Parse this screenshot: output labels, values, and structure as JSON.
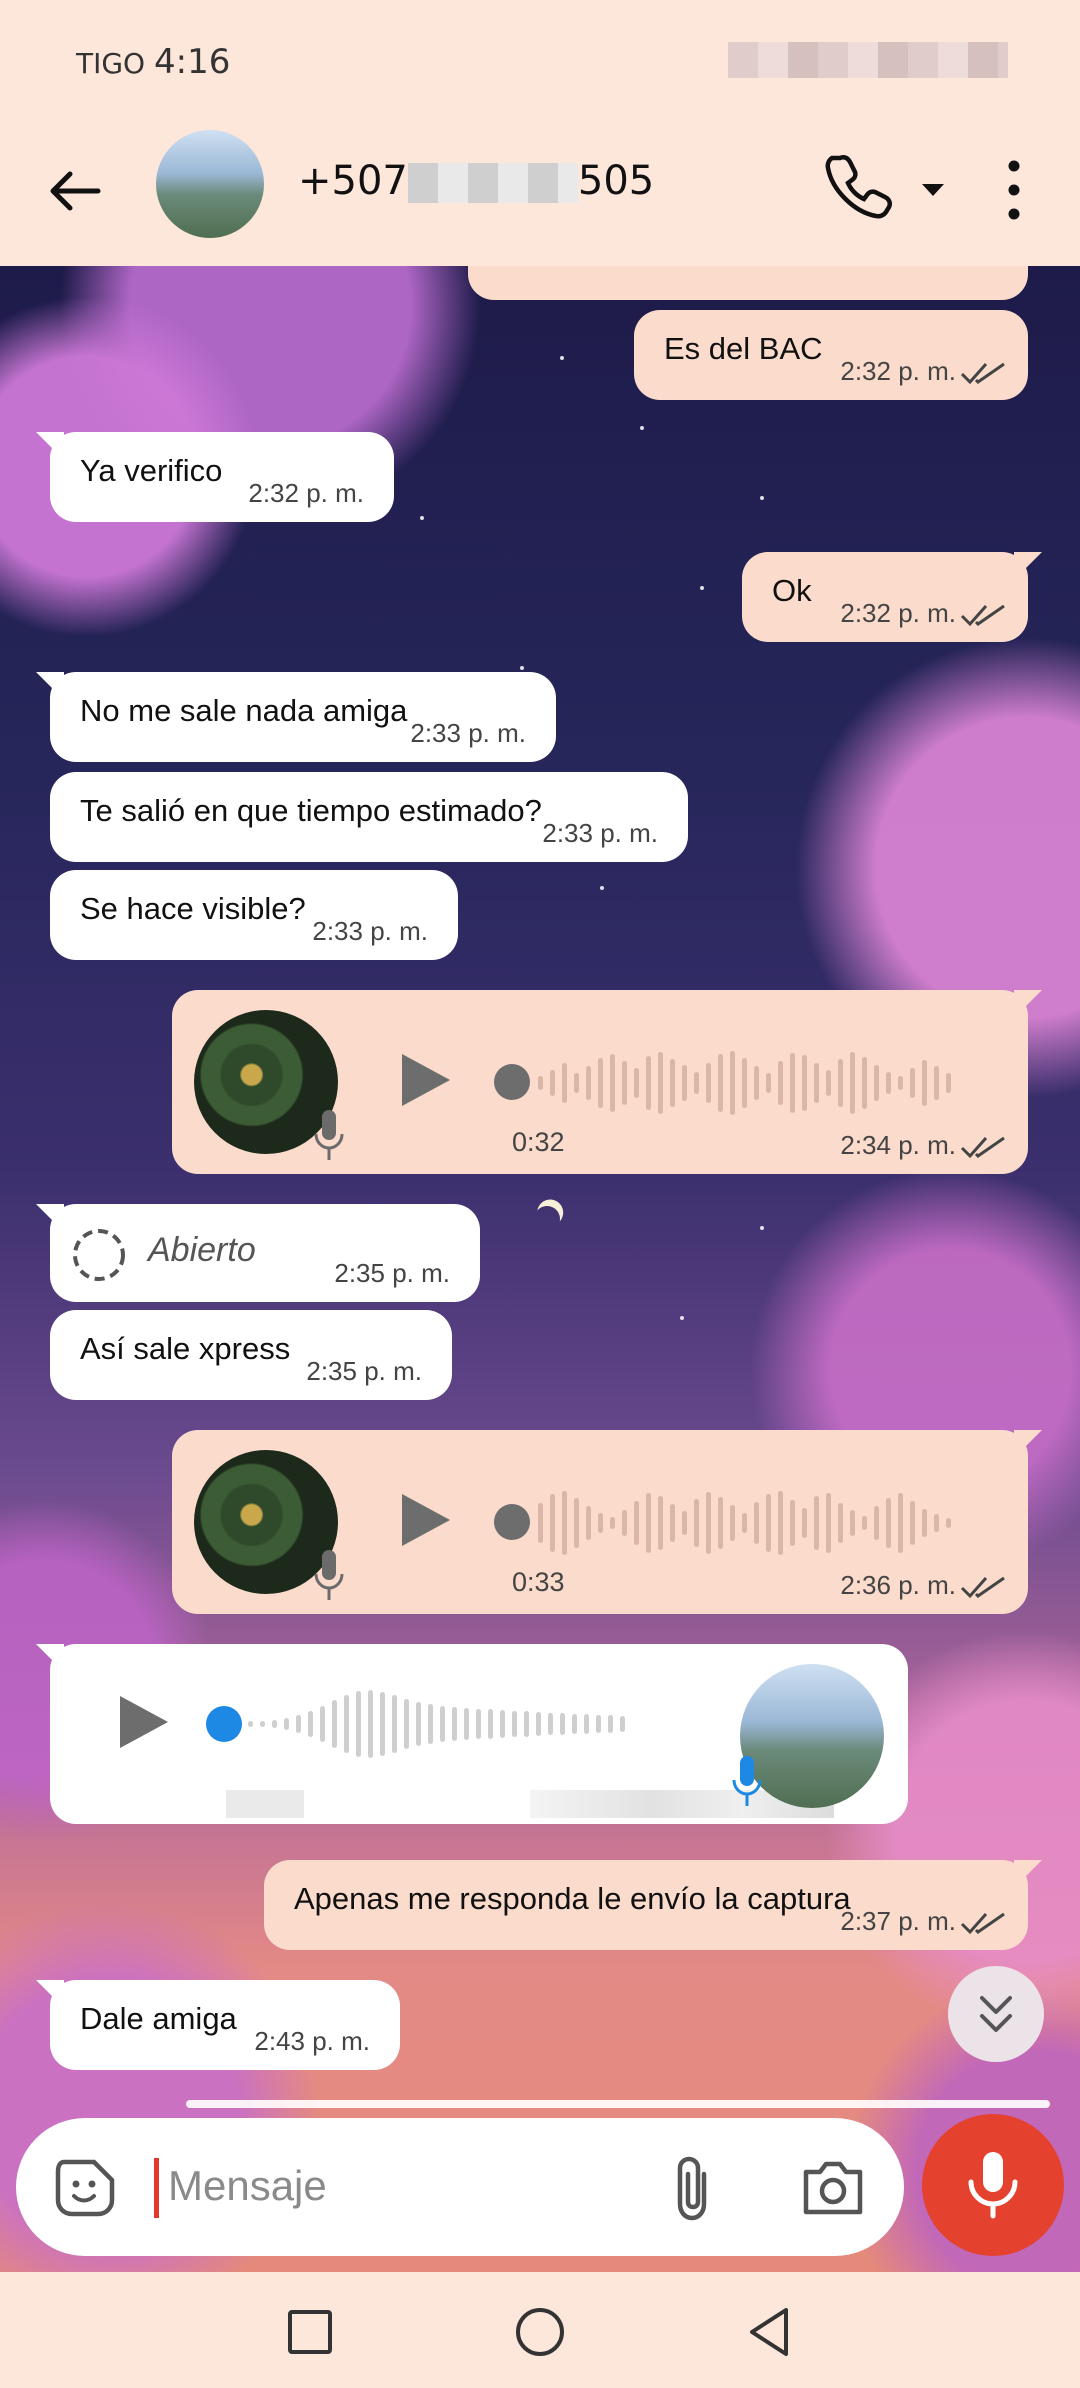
{
  "status_bar": {
    "carrier": "TIGO",
    "time": "4:16"
  },
  "header": {
    "contact_prefix": "+507",
    "contact_suffix": "505"
  },
  "messages": [
    {
      "dir": "out",
      "text": "Es del BAC",
      "time": "2:32 p. m."
    },
    {
      "dir": "in",
      "text": "Ya verifico",
      "time": "2:32 p. m."
    },
    {
      "dir": "out",
      "text": "Ok",
      "time": "2:32 p. m."
    },
    {
      "dir": "in",
      "text": "No me sale nada amiga",
      "time": "2:33 p. m."
    },
    {
      "dir": "in",
      "text": "Te salió en que tiempo estimado?",
      "time": "2:33 p. m."
    },
    {
      "dir": "in",
      "text": "Se hace visible?",
      "time": "2:33 p. m."
    },
    {
      "dir": "out",
      "type": "voice",
      "duration": "0:32",
      "time": "2:34 p. m."
    },
    {
      "dir": "in",
      "type": "view-once",
      "text": "Abierto",
      "time": "2:35 p. m."
    },
    {
      "dir": "in",
      "text": "Así sale xpress",
      "time": "2:35 p. m."
    },
    {
      "dir": "out",
      "type": "voice",
      "duration": "0:33",
      "time": "2:36 p. m."
    },
    {
      "dir": "in",
      "type": "voice"
    },
    {
      "dir": "out",
      "text": "Apenas me responda le envío la captura",
      "time": "2:37 p. m."
    },
    {
      "dir": "in",
      "text": "Dale amiga",
      "time": "2:43 p. m."
    }
  ],
  "composer": {
    "placeholder": "Mensaje"
  },
  "colors": {
    "accent": "#e4412f",
    "outgoing_bubble": "#fbdccc",
    "incoming_bubble": "#ffffff",
    "header_bg": "#fde6da",
    "voice_progress": "#1e88e5"
  },
  "icons": [
    "back-arrow-icon",
    "phone-icon",
    "caret-down-icon",
    "more-vert-icon",
    "double-check-icon",
    "play-icon",
    "mic-icon",
    "view-once-icon",
    "chevrons-down-icon",
    "sticker-icon",
    "paperclip-icon",
    "camera-icon",
    "nav-recents-icon",
    "nav-home-icon",
    "nav-back-icon"
  ]
}
